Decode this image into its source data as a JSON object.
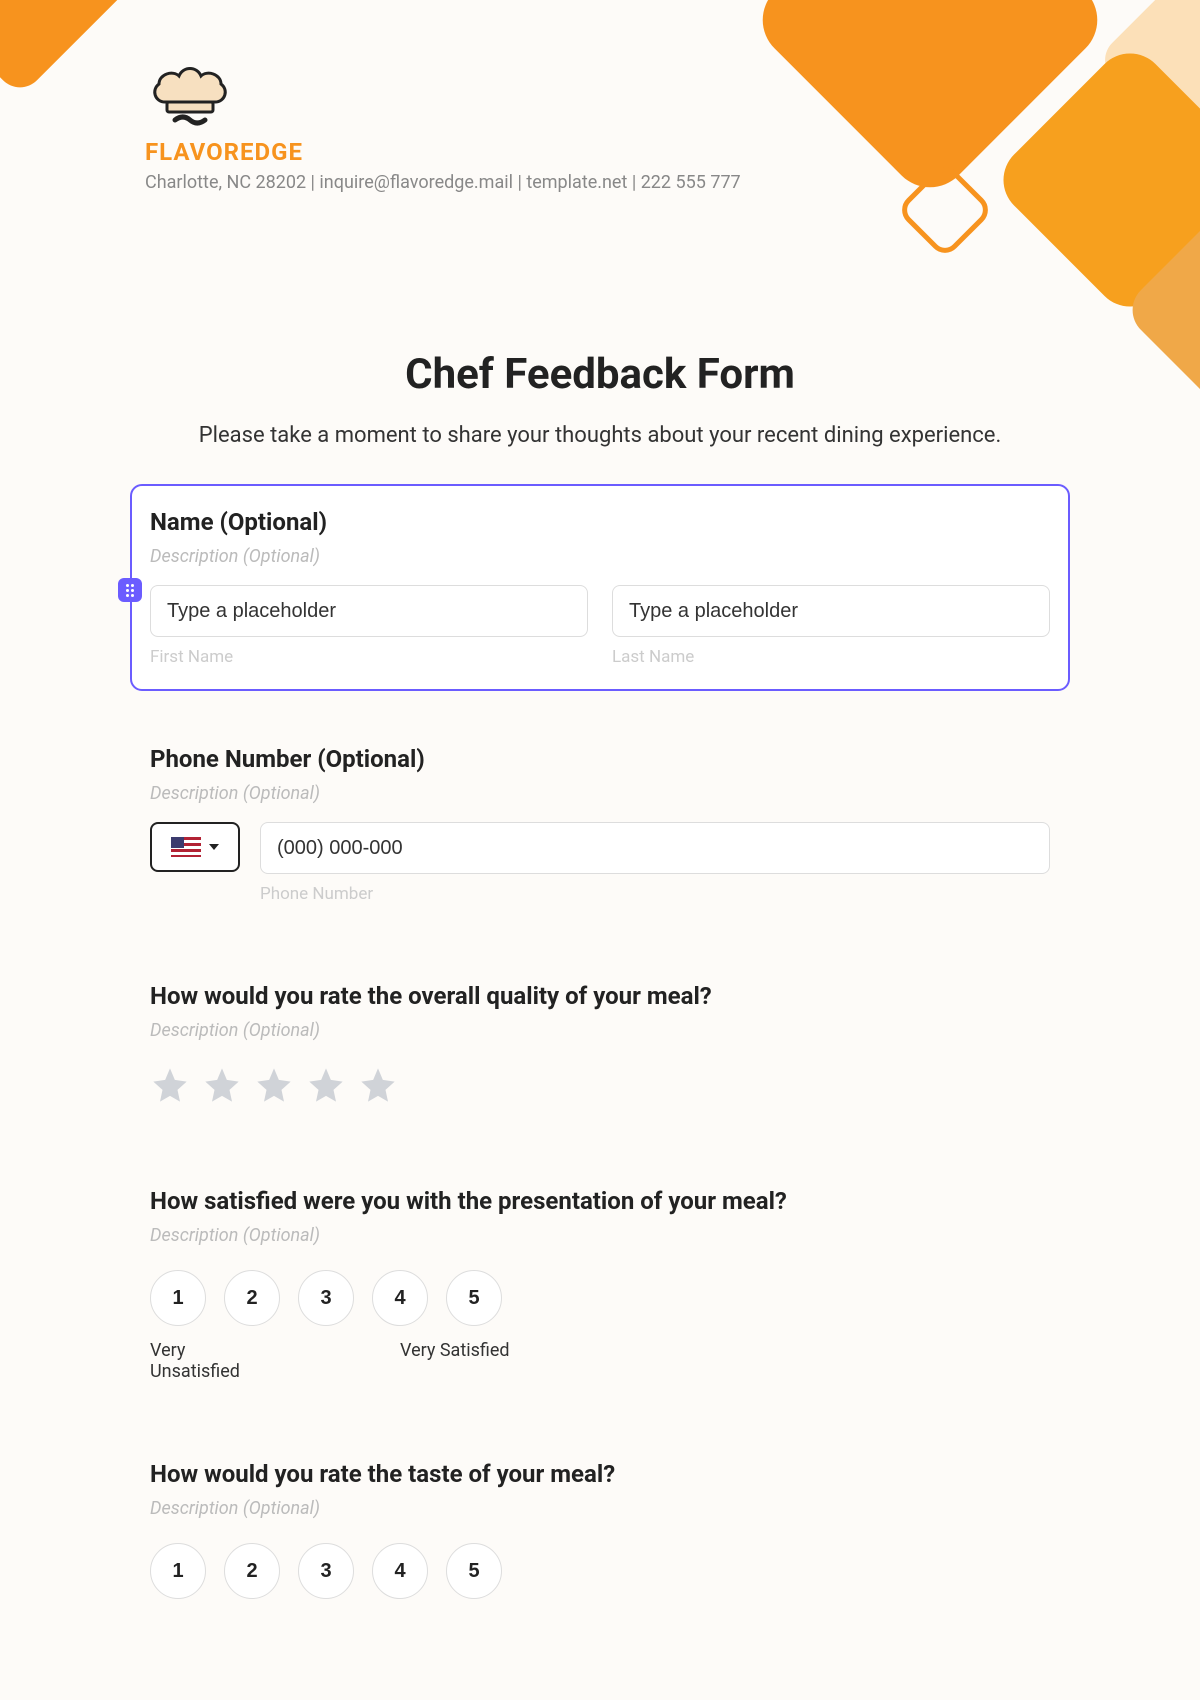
{
  "brand": {
    "name": "FLAVOREDGE",
    "contact": "Charlotte, NC 28202 | inquire@flavoredge.mail | template.net | 222 555 777"
  },
  "form": {
    "title": "Chef Feedback Form",
    "subtitle": "Please take a moment to share your thoughts about your recent dining experience."
  },
  "name_block": {
    "title": "Name (Optional)",
    "desc": "Description (Optional)",
    "first_placeholder": "Type a placeholder",
    "last_placeholder": "Type a placeholder",
    "first_label": "First Name",
    "last_label": "Last Name"
  },
  "phone_block": {
    "title": "Phone Number (Optional)",
    "desc": "Description (Optional)",
    "placeholder": "(000) 000-000",
    "label": "Phone Number"
  },
  "quality_block": {
    "title": "How would you rate the overall quality of your meal?",
    "desc": "Description (Optional)"
  },
  "presentation_block": {
    "title": "How satisfied were you with the presentation of your meal?",
    "desc": "Description (Optional)",
    "scale": [
      "1",
      "2",
      "3",
      "4",
      "5"
    ],
    "low_label": "Very Unsatisfied",
    "high_label": "Very Satisfied"
  },
  "taste_block": {
    "title": "How would you rate the taste of your meal?",
    "desc": "Description (Optional)",
    "scale": [
      "1",
      "2",
      "3",
      "4",
      "5"
    ]
  }
}
